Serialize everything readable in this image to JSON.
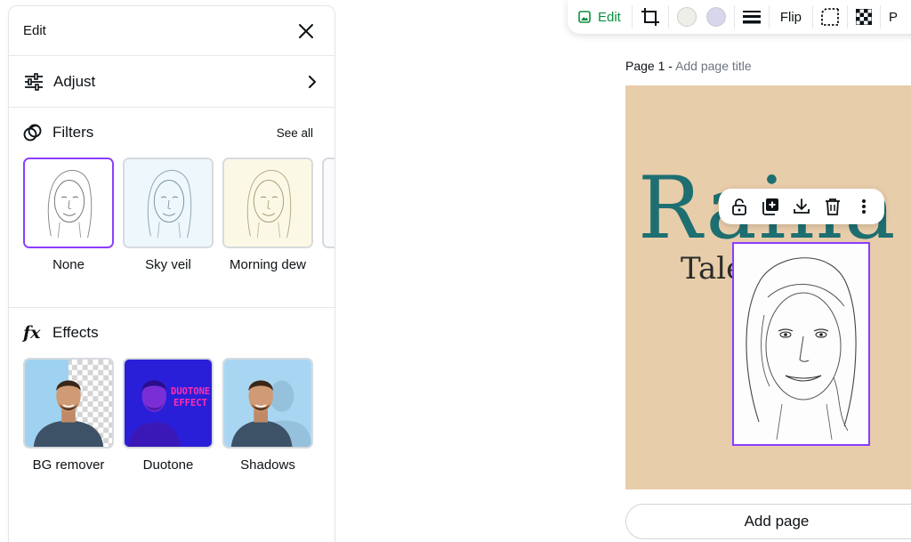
{
  "panel": {
    "title": "Edit",
    "adjust_label": "Adjust",
    "filters": {
      "title": "Filters",
      "see_all": "See all",
      "items": [
        {
          "label": "None",
          "selected": true
        },
        {
          "label": "Sky veil",
          "selected": false
        },
        {
          "label": "Morning dew",
          "selected": false
        }
      ]
    },
    "effects": {
      "title": "Effects",
      "items": [
        {
          "label": "BG remover"
        },
        {
          "label": "Duotone",
          "overlay_text": "DUOTONE EFFECT"
        },
        {
          "label": "Shadows"
        }
      ]
    }
  },
  "toolbar": {
    "edit_label": "Edit",
    "flip_label": "Flip",
    "swatch_colors": [
      "#eef0e8",
      "#d7d6ec"
    ],
    "accent_color": "#0a8f3e"
  },
  "canvas": {
    "page_label": "Page 1 -",
    "add_title_placeholder": "Add page title",
    "heading_text": "Raina fi",
    "subheading_text": "Tale          ne n",
    "background_color": "#e8cdaa",
    "heading_color": "#1e6f71",
    "selection_color": "#8b3dff",
    "add_page_label": "Add page"
  }
}
